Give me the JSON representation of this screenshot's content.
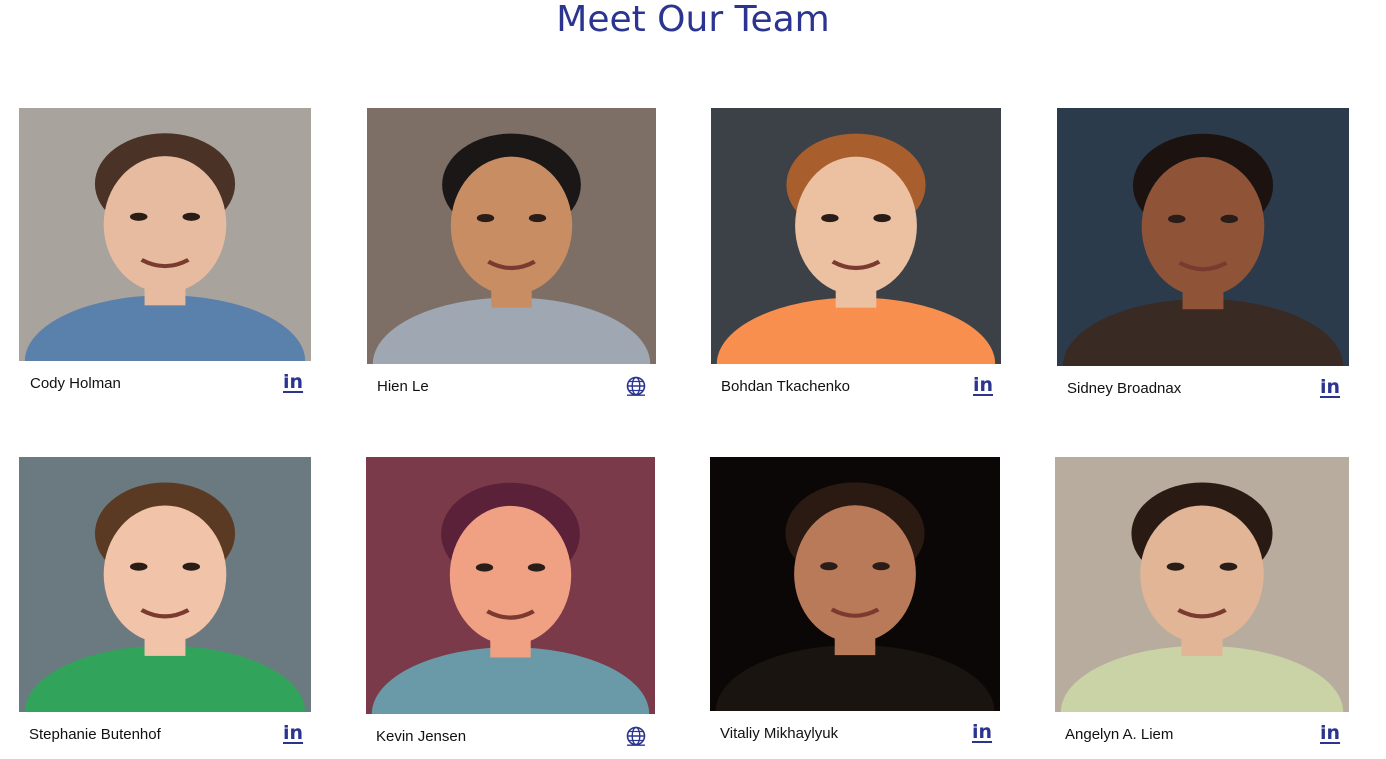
{
  "page": {
    "title": "Meet Our Team"
  },
  "accent_color": "#2b3590",
  "team": [
    {
      "name": "Cody Holman",
      "link_icon": "linkedin-icon",
      "link_glyph": "in",
      "photo_colors": {
        "bg": "#a8a39c",
        "skin": "#e7bba0",
        "hair": "#4a3326",
        "shirt": "#5a80ac"
      }
    },
    {
      "name": "Hien Le",
      "link_icon": "globe-icon",
      "link_glyph": "",
      "photo_colors": {
        "bg": "#7d6f66",
        "skin": "#c98d63",
        "hair": "#1a1716",
        "shirt": "#9fa7b3"
      }
    },
    {
      "name": "Bohdan Tkachenko",
      "link_icon": "linkedin-icon",
      "link_glyph": "in",
      "photo_colors": {
        "bg": "#3b4146",
        "skin": "#ebc1a2",
        "hair": "#a85f2d",
        "shirt": "#f88f4e"
      }
    },
    {
      "name": "Sidney Broadnax",
      "link_icon": "linkedin-icon",
      "link_glyph": "in",
      "photo_colors": {
        "bg": "#2c3b4c",
        "skin": "#8f5437",
        "hair": "#1c1210",
        "shirt": "#3a2a24"
      }
    },
    {
      "name": "Stephanie Butenhof",
      "link_icon": "linkedin-icon",
      "link_glyph": "in",
      "photo_colors": {
        "bg": "#6b7a80",
        "skin": "#f1c3a8",
        "hair": "#5a3a22",
        "shirt": "#32a35a"
      }
    },
    {
      "name": "Kevin Jensen",
      "link_icon": "globe-icon",
      "link_glyph": "",
      "photo_colors": {
        "bg": "#7a3a4a",
        "skin": "#f0a083",
        "hair": "#5a2138",
        "shirt": "#6a9aa8"
      }
    },
    {
      "name": "Vitaliy Mikhaylyuk",
      "link_icon": "linkedin-icon",
      "link_glyph": "in",
      "photo_colors": {
        "bg": "#0a0706",
        "skin": "#b87a58",
        "hair": "#2a1a12",
        "shirt": "#1a1410"
      }
    },
    {
      "name": "Angelyn A. Liem",
      "link_icon": "linkedin-icon",
      "link_glyph": "in",
      "photo_colors": {
        "bg": "#b8ac9e",
        "skin": "#e1b595",
        "hair": "#2a1a14",
        "shirt": "#c9d3a5"
      }
    }
  ]
}
